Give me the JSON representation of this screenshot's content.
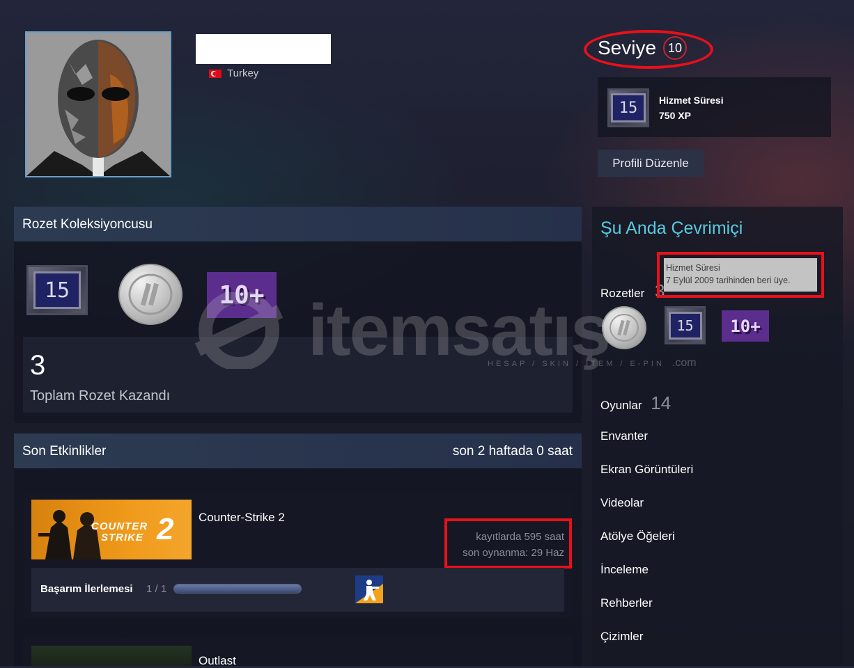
{
  "profile": {
    "country": "Turkey",
    "level_label": "Seviye",
    "level_value": "10",
    "xp_badge": {
      "title": "Hizmet Süresi",
      "xp": "750 XP",
      "badge_text": "15"
    },
    "edit_button": "Profili Düzenle"
  },
  "badge_collector": {
    "title": "Rozet Koleksiyoncusu",
    "badges": [
      {
        "icon": "years-of-service-15-badge",
        "text": "15"
      },
      {
        "icon": "silver-coin-badge"
      },
      {
        "icon": "games-10-plus-badge",
        "text": "10+"
      }
    ],
    "total_count": "3",
    "total_label": "Toplam Rozet Kazandı"
  },
  "recent_activity": {
    "title": "Son Etkinlikler",
    "summary": "son 2 haftada 0 saat",
    "games": [
      {
        "name": "Counter-Strike 2",
        "capsule_text_1": "COUNTER",
        "capsule_text_2": "STRIKE",
        "capsule_num": "2",
        "hours_on_record": "kayıtlarda 595 saat",
        "last_played": "son oynanma: 29 Haz",
        "achievement_label": "Başarım İlerlemesi",
        "achievement_count": "1 / 1",
        "achievement_progress": 1.0
      },
      {
        "name": "Outlast"
      }
    ]
  },
  "sidebar": {
    "status": "Şu Anda Çevrimiçi",
    "tooltip_line1": "Hizmet Süresi",
    "tooltip_line2": "7 Eylül 2009 tarihinden beri üye.",
    "badges_label": "Rozetler",
    "badges_count_partial": "3",
    "games_label": "Oyunlar",
    "games_count": "14",
    "links": [
      "Envanter",
      "Ekran Görüntüleri",
      "Videolar",
      "Atölye Öğeleri",
      "İnceleme",
      "Rehberler",
      "Çizimler"
    ]
  },
  "watermark": {
    "brand": "itemsatış",
    "sub": "HESAP / SKIN / ITEM / E-PIN",
    "domain": ".com"
  },
  "colors": {
    "status_online": "#57cbde",
    "highlight_red": "#e8101a",
    "cs_orange": "#f09a1b"
  }
}
